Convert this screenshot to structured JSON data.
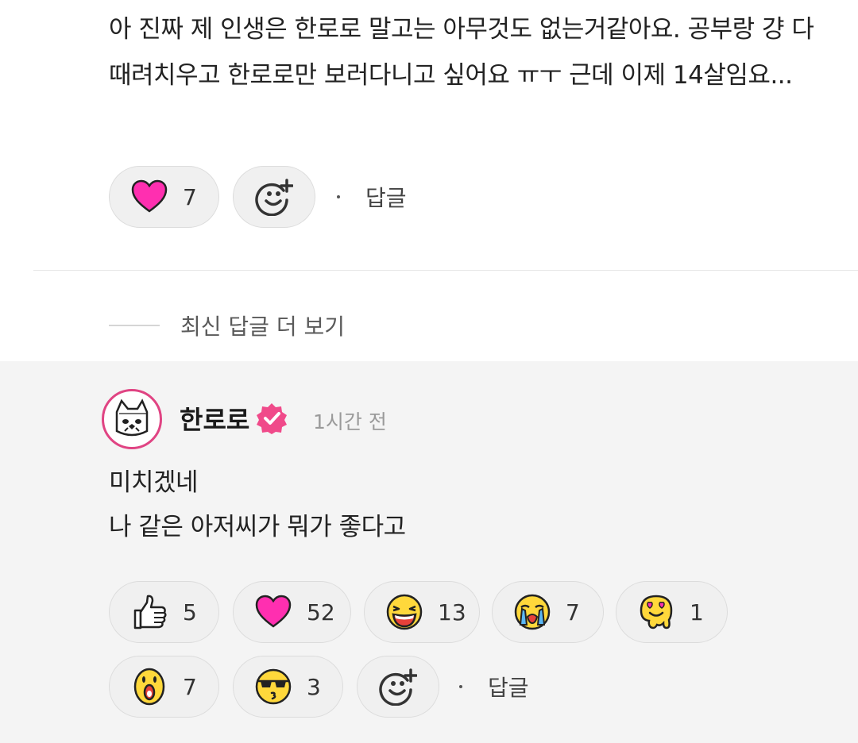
{
  "comment": {
    "text": "아 진짜 제 인생은 한로로 말고는 아무것도 없는거같아요. 공부랑 걍 다 때려치우고 한로로만 보러다니고 싶어요 ㅠㅜ 근데 이제 14살임요...",
    "reactions": [
      {
        "icon": "heart-icon",
        "count": "7"
      }
    ],
    "add_reaction_icon": "add-emoji-icon",
    "reply_label": "답글"
  },
  "more_replies": {
    "label": "최신 답글 더 보기"
  },
  "reply": {
    "author": "한로로",
    "verified_icon": "verified-badge-icon",
    "time": "1시간 전",
    "text_line1": "미치겠네",
    "text_line2": "나 같은 아저씨가 뭐가 좋다고",
    "reactions": [
      {
        "icon": "thumbs-up-icon",
        "count": "5"
      },
      {
        "icon": "heart-icon",
        "count": "52"
      },
      {
        "icon": "laughing-face-icon",
        "count": "13"
      },
      {
        "icon": "crying-face-icon",
        "count": "7"
      },
      {
        "icon": "melting-heart-eyes-icon",
        "count": "1"
      },
      {
        "icon": "surprised-face-icon",
        "count": "7"
      },
      {
        "icon": "sunglasses-kiss-face-icon",
        "count": "3"
      }
    ],
    "add_reaction_icon": "add-emoji-icon",
    "reply_label": "답글"
  },
  "colors": {
    "heart": "#ff2fb0",
    "emoji_yellow": "#ffd83b",
    "verified": "#f04a8a",
    "avatar_ring": "#e04483",
    "reply_bg": "#f4f4f4",
    "pill_bg": "#f0f0f0"
  }
}
